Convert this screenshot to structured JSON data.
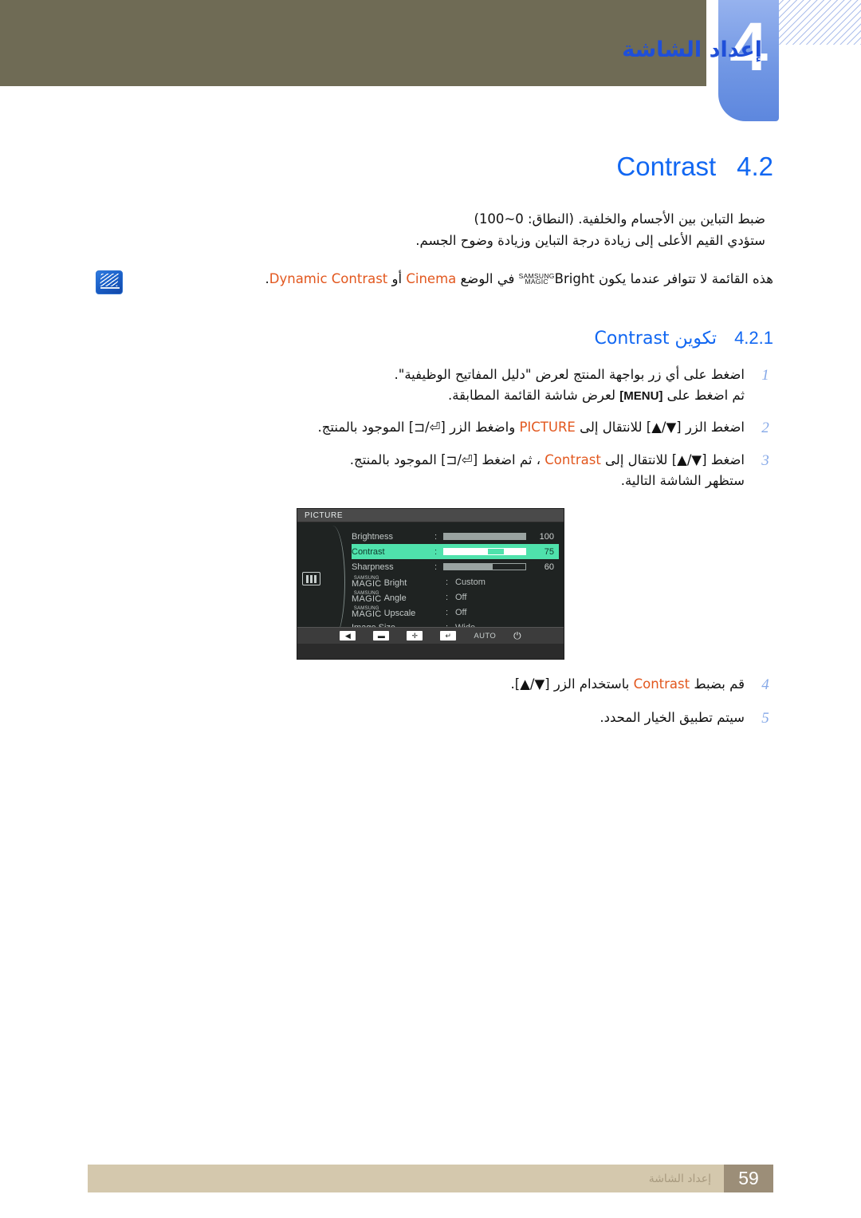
{
  "header": {
    "chapter_number": "4",
    "chapter_title": "إعداد الشاشة"
  },
  "section": {
    "number": "4.2",
    "title": "Contrast",
    "description_line1": "ضبط التباين بين الأجسام والخلفية. (النطاق: 0~100)",
    "description_line2": "ستؤدي القيم الأعلى إلى زيادة درجة التباين وزيادة وضوح الجسم."
  },
  "note": {
    "icon": "note-pencil-icon",
    "text_before": "هذه القائمة لا تتوافر عندما يكون",
    "magic_top": "SAMSUNG",
    "magic_bottom": "MAGIC",
    "magic_word": "Bright",
    "text_mid": "في الوضع",
    "highlight1": "Cinema",
    "text_or": "أو",
    "highlight2": "Dynamic Contrast",
    "text_end": "."
  },
  "subsection": {
    "number": "4.2.1",
    "title_ar": "تكوين",
    "title_en": "Contrast"
  },
  "steps": [
    {
      "num": "1",
      "line1": "اضغط على أي زر بواجهة المنتج لعرض \"دليل المفاتيح الوظيفية\".",
      "line2_pre": "ثم اضغط على",
      "line2_key": "[MENU]",
      "line2_post": "لعرض شاشة القائمة المطابقة."
    },
    {
      "num": "2",
      "line1_pre": "اضغط الزر",
      "line1_key1": "[▲/▼]",
      "line1_mid": "للانتقال إلى",
      "line1_hl": "PICTURE",
      "line1_mid2": "واضغط الزر",
      "line1_key2": "[⊐/⏎]",
      "line1_post": "الموجود بالمنتج."
    },
    {
      "num": "3",
      "line1_pre": "اضغط",
      "line1_key1": "[▲/▼]",
      "line1_mid": "للانتقال إلى",
      "line1_hl": "Contrast",
      "line1_mid2": "، ثم اضغط",
      "line1_key2": "[⊐/⏎]",
      "line1_post": "الموجود بالمنتج.",
      "line2": "ستظهر الشاشة التالية."
    },
    {
      "num": "4",
      "line1_pre": "قم بضبط",
      "line1_hl": "Contrast",
      "line1_mid": "باستخدام الزر",
      "line1_key1": "[▲/▼]",
      "line1_post": "."
    },
    {
      "num": "5",
      "line1": "سيتم تطبيق الخيار المحدد."
    }
  ],
  "osd": {
    "header_label": "PICTURE",
    "category_icon": "picture-bars-icon",
    "rows": [
      {
        "label": "Brightness",
        "type": "slider",
        "value": "100",
        "fill_pct": 100
      },
      {
        "label": "Contrast",
        "type": "slider",
        "value": "75",
        "fill_pct": 75,
        "highlighted": true
      },
      {
        "label": "Sharpness",
        "type": "slider",
        "value": "60",
        "fill_pct": 60
      },
      {
        "label": "Bright",
        "type": "magic",
        "value": "Custom",
        "magic_top": "SAMSUNG",
        "magic_bottom": "MAGIC"
      },
      {
        "label": "Angle",
        "type": "magic",
        "value": "Off",
        "magic_top": "SAMSUNG",
        "magic_bottom": "MAGIC"
      },
      {
        "label": "Upscale",
        "type": "magic",
        "value": "Off",
        "magic_top": "SAMSUNG",
        "magic_bottom": "MAGIC"
      },
      {
        "label": "Image Size",
        "type": "text",
        "value": "Wide"
      }
    ],
    "scroll_caret": "▼",
    "footer_buttons": [
      {
        "name": "back-icon",
        "glyph": "◀"
      },
      {
        "name": "minus-icon",
        "glyph": "▬"
      },
      {
        "name": "plus-icon",
        "glyph": "✛"
      },
      {
        "name": "enter-icon",
        "glyph": "↵"
      },
      {
        "name": "auto-label",
        "glyph": "AUTO"
      },
      {
        "name": "power-icon",
        "glyph": "⏻"
      }
    ]
  },
  "footer": {
    "page_number": "59",
    "text": "إعداد الشاشة"
  },
  "colors": {
    "accent_blue": "#1167f2",
    "highlight_orange": "#e2571e",
    "osd_highlight_green": "#4fe2ac",
    "header_olive": "#6f6b55",
    "footer_tan": "#d4c8ad",
    "page_badge": "#9c8e78"
  }
}
